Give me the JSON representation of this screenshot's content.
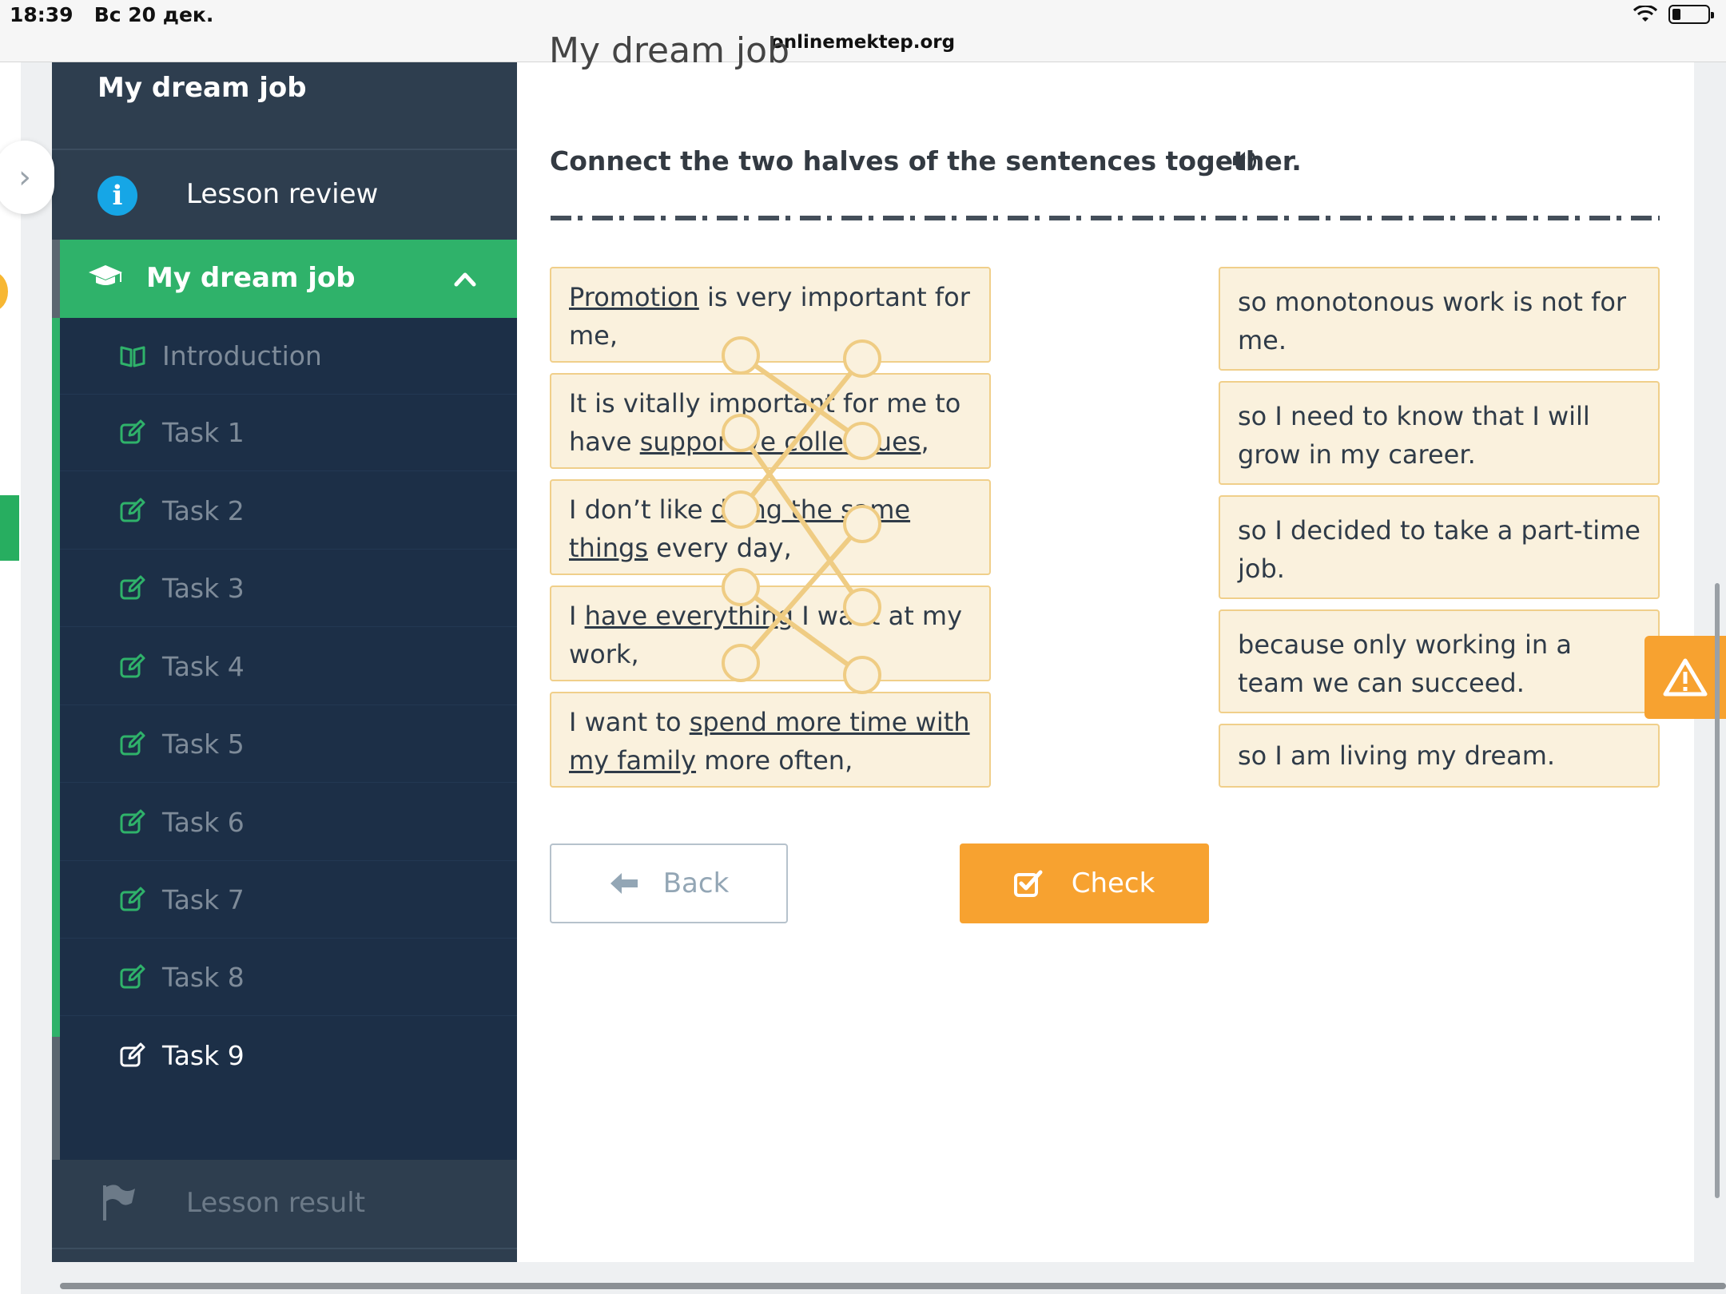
{
  "status_bar": {
    "time": "18:39",
    "date": "Вс 20 дек.",
    "url": "onlinemektep.org"
  },
  "page": {
    "title": "My dream job"
  },
  "sidebar": {
    "title": "My dream job",
    "review_label": "Lesson review",
    "module_label": "My dream job",
    "items": [
      {
        "label": "Introduction",
        "icon": "book-icon"
      },
      {
        "label": "Task 1",
        "icon": "edit-icon"
      },
      {
        "label": "Task 2",
        "icon": "edit-icon"
      },
      {
        "label": "Task 3",
        "icon": "edit-icon"
      },
      {
        "label": "Task 4",
        "icon": "edit-icon"
      },
      {
        "label": "Task 5",
        "icon": "edit-icon"
      },
      {
        "label": "Task 6",
        "icon": "edit-icon"
      },
      {
        "label": "Task 7",
        "icon": "edit-icon"
      },
      {
        "label": "Task 8",
        "icon": "edit-icon"
      },
      {
        "label": "Task 9",
        "icon": "edit-icon"
      }
    ],
    "active_item": "Task 9",
    "result_label": "Lesson result"
  },
  "task": {
    "instruction": "Connect the two halves of the sentences together.",
    "left": [
      {
        "parts": [
          {
            "u": "Promotion"
          },
          {
            "t": " is very important for me,"
          }
        ]
      },
      {
        "parts": [
          {
            "t": "It is vitally important for me to have "
          },
          {
            "u": "supportive colleagues"
          },
          {
            "t": ","
          }
        ]
      },
      {
        "parts": [
          {
            "t": "I don’t like "
          },
          {
            "u": "doing the same things"
          },
          {
            "t": " every day,"
          }
        ]
      },
      {
        "parts": [
          {
            "t": "I "
          },
          {
            "u": "have everything"
          },
          {
            "t": " I want at my work,"
          }
        ]
      },
      {
        "parts": [
          {
            "t": "I want to "
          },
          {
            "u": "spend more time with my family"
          },
          {
            "t": " more often,"
          }
        ]
      }
    ],
    "right": [
      "so monotonous work is not for me.",
      "so I need to know that I will grow in my career.",
      "so I decided to take a part-time job.",
      "because only working in a team we can succeed.",
      "so I am living my dream."
    ],
    "connections": [
      [
        0,
        1
      ],
      [
        1,
        3
      ],
      [
        2,
        0
      ],
      [
        3,
        4
      ],
      [
        4,
        2
      ]
    ],
    "line_color": "#efcc83"
  },
  "buttons": {
    "back": "Back",
    "check": "Check"
  },
  "colors": {
    "accent_green": "#2fb26a",
    "accent_orange": "#f7a230",
    "sidebar_dark": "#1c2f47"
  }
}
